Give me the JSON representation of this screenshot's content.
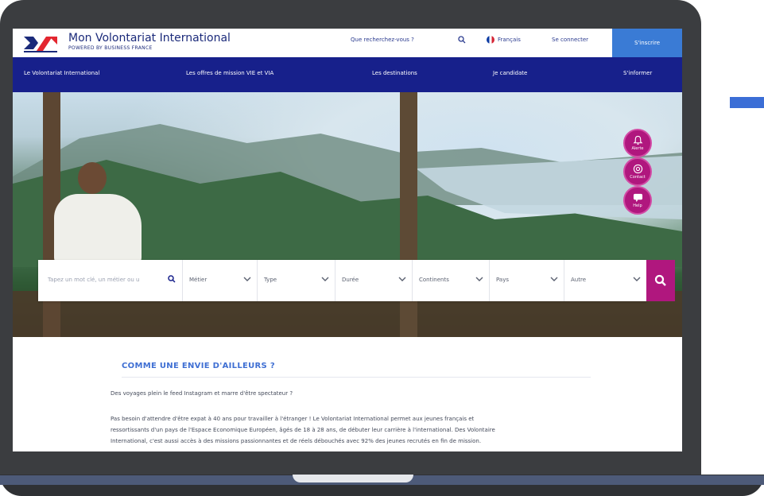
{
  "header": {
    "brand": "Mon Volontariat International",
    "brand_sub": "POWERED BY BUSINESS FRANCE",
    "search_link": "Que recherchez-vous ?",
    "language": "Français",
    "login": "Se connecter",
    "signup": "S'inscrire"
  },
  "nav": [
    "Le Volontariat International",
    "Les offres de mission VIE et VIA",
    "Les destinations",
    "Je candidate",
    "S'informer"
  ],
  "fabs": [
    {
      "label": "Alerte",
      "icon": "bell-icon"
    },
    {
      "label": "Contact",
      "icon": "at-icon"
    },
    {
      "label": "Help",
      "icon": "help-icon"
    }
  ],
  "searchbar": {
    "keyword_placeholder": "Tapez un mot clé, un métier ou u",
    "filters": [
      "Métier",
      "Type",
      "Durée",
      "Continents",
      "Pays",
      "Autre"
    ]
  },
  "content": {
    "heading": "COMME UNE ENVIE D'AILLEURS ?",
    "intro": "Des voyages plein le feed Instagram et marre d'être spectateur ?",
    "body_lines": [
      "Pas besoin d'attendre d'être expat à 40 ans pour travailler à l'étranger ! Le Volontariat International permet aux jeunes français et",
      "ressortissants d'un pays de l'Espace Economique Européen, âgés de 18 à 28 ans, de débuter leur carrière à l'international. Des Volontaire",
      "International, c'est aussi accès à des missions passionnantes et de réels débouchés avec 92% des jeunes recrutés en fin de mission."
    ]
  },
  "colors": {
    "nav_blue": "#17208b",
    "accent_magenta": "#b0177e",
    "signup_blue": "#3a7bd5",
    "heading_blue": "#3f6fd3"
  }
}
